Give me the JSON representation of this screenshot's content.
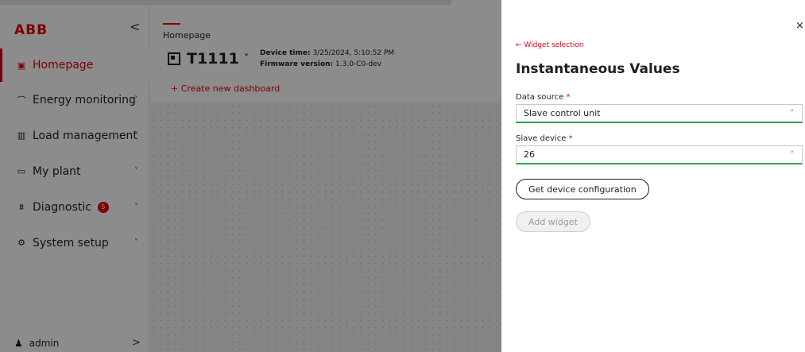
{
  "brand": {
    "logo": "ABB",
    "collapse_glyph": "<"
  },
  "sidebar": {
    "items": [
      {
        "label": "Homepage",
        "icon": "home-icon",
        "glyph": "▣",
        "active": true
      },
      {
        "label": "Energy monitoring",
        "icon": "energy-icon",
        "glyph": "⌒",
        "chevron": "˅"
      },
      {
        "label": "Load management",
        "icon": "load-chart-icon",
        "glyph": "▥",
        "chevron": "˅"
      },
      {
        "label": "My plant",
        "icon": "plant-monitor-icon",
        "glyph": "▭",
        "chevron": "˅"
      },
      {
        "label": "Diagnostic",
        "icon": "pulse-icon",
        "glyph": "⩩",
        "badge": "5",
        "chevron": "˅"
      },
      {
        "label": "System setup",
        "icon": "gear-icon",
        "glyph": "⚙",
        "chevron": "˅"
      }
    ],
    "user": {
      "name": "admin",
      "icon": "user-icon",
      "glyph": "♟",
      "chevron": ">"
    }
  },
  "main": {
    "breadcrumb": "Homepage",
    "device_name": "T1111",
    "device_chevron": "˅",
    "device_time_label": "Device time:",
    "device_time": "3/25/2024, 5:10:52 PM",
    "firmware_label": "Firmware version:",
    "firmware": "1.3.0-C0-dev",
    "create_dashboard": "+ Create new dashboard"
  },
  "panel": {
    "close_glyph": "×",
    "back_link": "← Widget selection",
    "title": "Instantaneous Values",
    "data_source": {
      "label": "Data source",
      "required": "*",
      "value": "Slave control unit"
    },
    "slave_device": {
      "label": "Slave device",
      "required": "*",
      "value": "26"
    },
    "select_chevron": "˅",
    "get_config_button": "Get device configuration",
    "add_widget_button": "Add widget"
  },
  "colors": {
    "accent": "#e2000f",
    "valid": "#2ea44f",
    "overlay": "rgba(0,0,0,0.45)"
  }
}
